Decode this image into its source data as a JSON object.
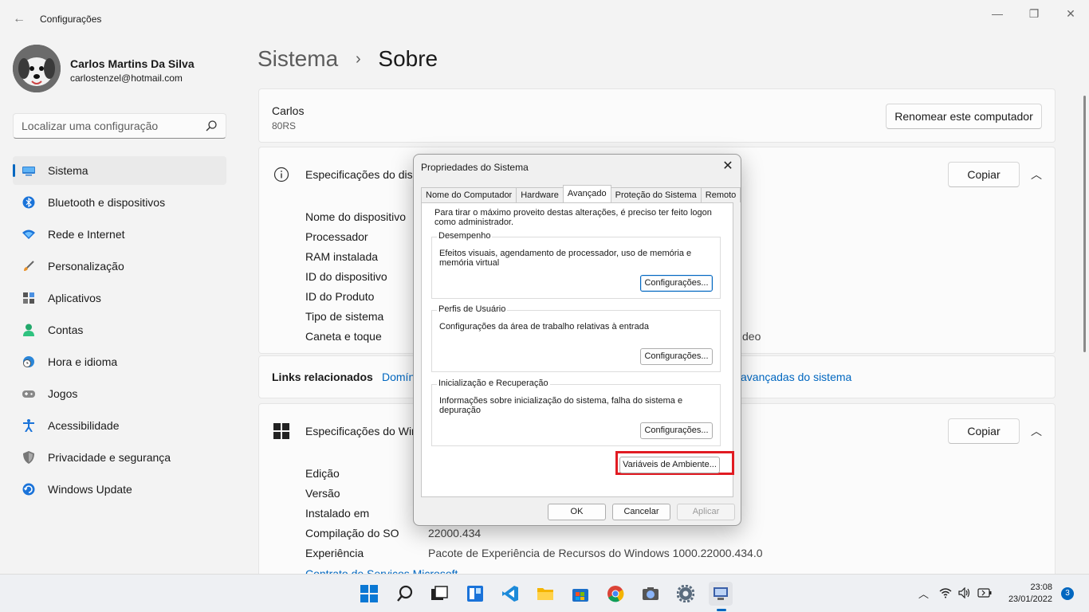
{
  "window": {
    "app_title": "Configurações",
    "minimize": "—",
    "maximize": "❐",
    "close": "✕"
  },
  "profile": {
    "name": "Carlos Martins Da Silva",
    "email": "carlostenzel@hotmail.com"
  },
  "search": {
    "placeholder": "Localizar uma configuração"
  },
  "sidebar": {
    "items": [
      {
        "label": "Sistema",
        "icon": "monitor-icon"
      },
      {
        "label": "Bluetooth e dispositivos",
        "icon": "bluetooth-icon"
      },
      {
        "label": "Rede e Internet",
        "icon": "wifi-icon"
      },
      {
        "label": "Personalização",
        "icon": "brush-icon"
      },
      {
        "label": "Aplicativos",
        "icon": "apps-icon"
      },
      {
        "label": "Contas",
        "icon": "person-icon"
      },
      {
        "label": "Hora e idioma",
        "icon": "clock-globe-icon"
      },
      {
        "label": "Jogos",
        "icon": "gamepad-icon"
      },
      {
        "label": "Acessibilidade",
        "icon": "accessibility-icon"
      },
      {
        "label": "Privacidade e segurança",
        "icon": "shield-icon"
      },
      {
        "label": "Windows Update",
        "icon": "update-icon"
      }
    ]
  },
  "breadcrumb": {
    "parent": "Sistema",
    "current": "Sobre"
  },
  "computer": {
    "name": "Carlos",
    "model": "80RS",
    "rename_button": "Renomear este computador"
  },
  "device_specs": {
    "title": "Especificações do disp",
    "copy_button": "Copiar",
    "labels": [
      "Nome do dispositivo",
      "Processador",
      "RAM instalada",
      "ID do dispositivo",
      "ID do Produto",
      "Tipo de sistema",
      "Caneta e toque"
    ],
    "partial_value": "deo"
  },
  "related_links": {
    "title": "Links relacionados",
    "link1": "Domín",
    "link2": "avançadas do sistema"
  },
  "windows_specs": {
    "title": "Especificações do Win",
    "copy_button": "Copiar",
    "labels": [
      "Edição",
      "Versão",
      "Instalado em",
      "Compilação do SO",
      "Experiência"
    ],
    "build_value": "22000.434",
    "experience_value": "Pacote de Experiência de Recursos do Windows 1000.22000.434.0",
    "link": "Contrato de Serviços Microsoft"
  },
  "dialog": {
    "title": "Propriedades do Sistema",
    "tabs": [
      "Nome do Computador",
      "Hardware",
      "Avançado",
      "Proteção do Sistema",
      "Remoto"
    ],
    "active_tab": "Avançado",
    "note": "Para tirar o máximo proveito destas alterações, é preciso ter feito logon como administrador.",
    "groups": [
      {
        "title": "Desempenho",
        "desc": "Efeitos visuais, agendamento de processador, uso de memória e memória virtual",
        "button": "Configurações..."
      },
      {
        "title": "Perfis de Usuário",
        "desc": "Configurações da área de trabalho relativas à entrada",
        "button": "Configurações..."
      },
      {
        "title": "Inicialização e Recuperação",
        "desc": "Informações sobre inicialização do sistema, falha do sistema e depuração",
        "button": "Configurações..."
      }
    ],
    "env_button": "Variáveis de Ambiente...",
    "ok": "OK",
    "cancel": "Cancelar",
    "apply": "Aplicar",
    "highlight_color": "#e11b22"
  },
  "taskbar": {
    "icons": [
      "windows-start-icon",
      "search-icon",
      "task-view-icon",
      "widgets-icon",
      "vscode-icon",
      "file-explorer-icon",
      "store-icon",
      "chrome-icon",
      "camera-icon",
      "settings-icon",
      "system-properties-icon"
    ],
    "time": "23:08",
    "date": "23/01/2022",
    "notifications": "3"
  },
  "colors": {
    "accent": "#0067c0",
    "background": "#f3f3f3"
  }
}
